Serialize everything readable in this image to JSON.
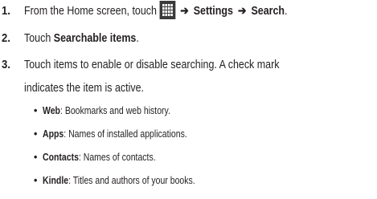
{
  "steps": [
    {
      "number": "1.",
      "prefix": "From the Home screen, touch",
      "icon": "apps-grid-icon",
      "path": [
        "Settings",
        "Search"
      ],
      "arrow": "➔",
      "suffix": "."
    },
    {
      "number": "2.",
      "prefix": "Touch",
      "bold": "Searchable items",
      "suffix": "."
    },
    {
      "number": "3.",
      "line1": "Touch items to enable or disable searching. A check mark",
      "line2": "indicates the item is active."
    }
  ],
  "bullets": [
    {
      "marker": "•",
      "term": "Web",
      "desc": ": Bookmarks and web history."
    },
    {
      "marker": "•",
      "term": "Apps",
      "desc": ": Names of installed applications."
    },
    {
      "marker": "•",
      "term": "Contacts",
      "desc": ": Names of contacts."
    },
    {
      "marker": "•",
      "term": "Kindle",
      "desc": ": Titles and authors of your books."
    }
  ],
  "colors": {
    "text": "#231f20",
    "icon_bg": "#3a3a3a",
    "icon_fg": "#ffffff"
  }
}
